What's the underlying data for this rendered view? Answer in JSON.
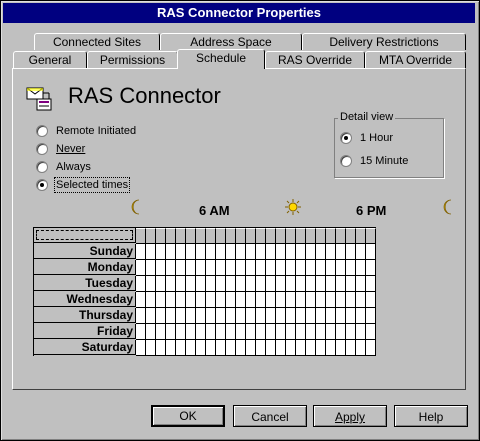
{
  "window": {
    "title": "RAS Connector Properties"
  },
  "tabs": {
    "row1": [
      "Connected Sites",
      "Address Space",
      "Delivery Restrictions"
    ],
    "row2": [
      "General",
      "Permissions",
      "Schedule",
      "RAS Override",
      "MTA Override"
    ],
    "active": "Schedule"
  },
  "heading": {
    "title": "RAS Connector",
    "icon": "connector-icon"
  },
  "schedule_options": [
    {
      "label": "Remote Initiated",
      "selected": false
    },
    {
      "label": "Never",
      "selected": false
    },
    {
      "label": "Always",
      "selected": false
    },
    {
      "label": "Selected times",
      "selected": true
    }
  ],
  "detail_view": {
    "label": "Detail view",
    "options": [
      {
        "label": "1 Hour",
        "selected": true
      },
      {
        "label": "15 Minute",
        "selected": false
      }
    ]
  },
  "timeline": {
    "labels": [
      "6 AM",
      "6 PM"
    ],
    "icons": [
      "moon-icon",
      "sun-icon",
      "moon-icon"
    ]
  },
  "days": [
    "Sunday",
    "Monday",
    "Tuesday",
    "Wednesday",
    "Thursday",
    "Friday",
    "Saturday"
  ],
  "hours_count": 24,
  "buttons": {
    "ok": "OK",
    "cancel": "Cancel",
    "apply": "Apply",
    "help": "Help"
  }
}
